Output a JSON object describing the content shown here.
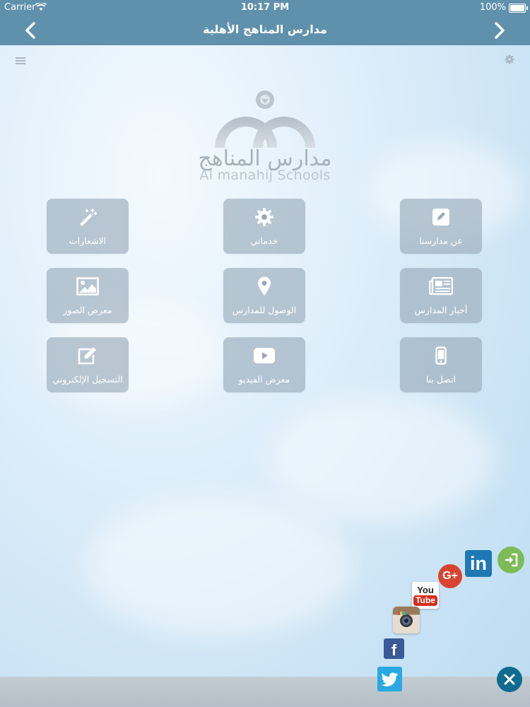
{
  "status_bar": {
    "carrier": "Carrier",
    "time": "10:17 PM",
    "battery": "100%"
  },
  "navbar": {
    "title": "مدارس المناهج الأهلية"
  },
  "logo": {
    "arabic": "مدارس المناهج",
    "english": "Al manahij Schools"
  },
  "tiles": [
    {
      "label": "عن مدارسنا",
      "icon": "edit-pencil-icon"
    },
    {
      "label": "خدماتي",
      "icon": "gear-icon"
    },
    {
      "label": "الاشعارات",
      "icon": "magic-wand-icon"
    },
    {
      "label": "أخبار المدارس",
      "icon": "newspaper-icon"
    },
    {
      "label": "الوصول للمدارس",
      "icon": "map-pin-icon"
    },
    {
      "label": "معرض الصور",
      "icon": "picture-icon"
    },
    {
      "label": "اتصل بنا",
      "icon": "mobile-phone-icon"
    },
    {
      "label": "معرض الفيديو",
      "icon": "play-video-icon"
    },
    {
      "label": "التسجيل الإلكتروني",
      "icon": "edit-form-icon"
    }
  ],
  "social": {
    "linkedin": "in",
    "googleplus": "G+",
    "youtube_top": "You",
    "youtube_bottom": "Tube",
    "facebook": "f"
  },
  "colors": {
    "navbar": "#5f91ad",
    "tile": "#96a8b8",
    "close_button": "#0f6b8f"
  }
}
